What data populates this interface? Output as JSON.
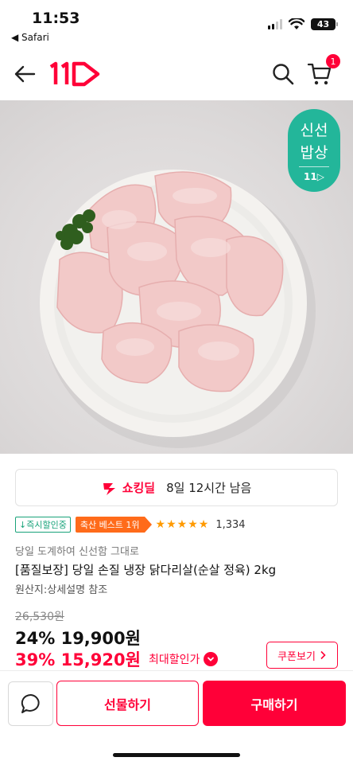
{
  "status_bar": {
    "time": "11:53",
    "back_app": "◀ Safari",
    "battery": "43"
  },
  "header": {
    "logo_icon": "11st-logo",
    "cart_count": "1"
  },
  "hero": {
    "badge_line1": "신선",
    "badge_line2": "밥상",
    "badge_logo": "11▷"
  },
  "deal": {
    "label": "쇼킹딜",
    "remaining": "8일 12시간 남음",
    "icon": "shocking-deal-icon"
  },
  "badges": {
    "instant": "↓즉시할인중",
    "best": "축산 베스트 1위",
    "stars": "★★★★★",
    "review_count": "1,334"
  },
  "product": {
    "subtitle": "당일 도계하여 신선함 그대로",
    "title": "[품질보장] 당일 손질 냉장 닭다리살(순살 정육) 2kg",
    "origin": "원산지:상세설명 참조"
  },
  "price": {
    "original": "26,530원",
    "line1": "24% 19,900원",
    "line2": "39% 15,920원",
    "max_discount": "최대할인가",
    "coupon": "쿠폰보기"
  },
  "bottom": {
    "gift": "선물하기",
    "buy": "구매하기"
  },
  "colors": {
    "brand": "#ff0038",
    "fresh_badge": "#23b69a",
    "best_badge": "#ff6b1a",
    "instant_badge": "#19a37a"
  }
}
